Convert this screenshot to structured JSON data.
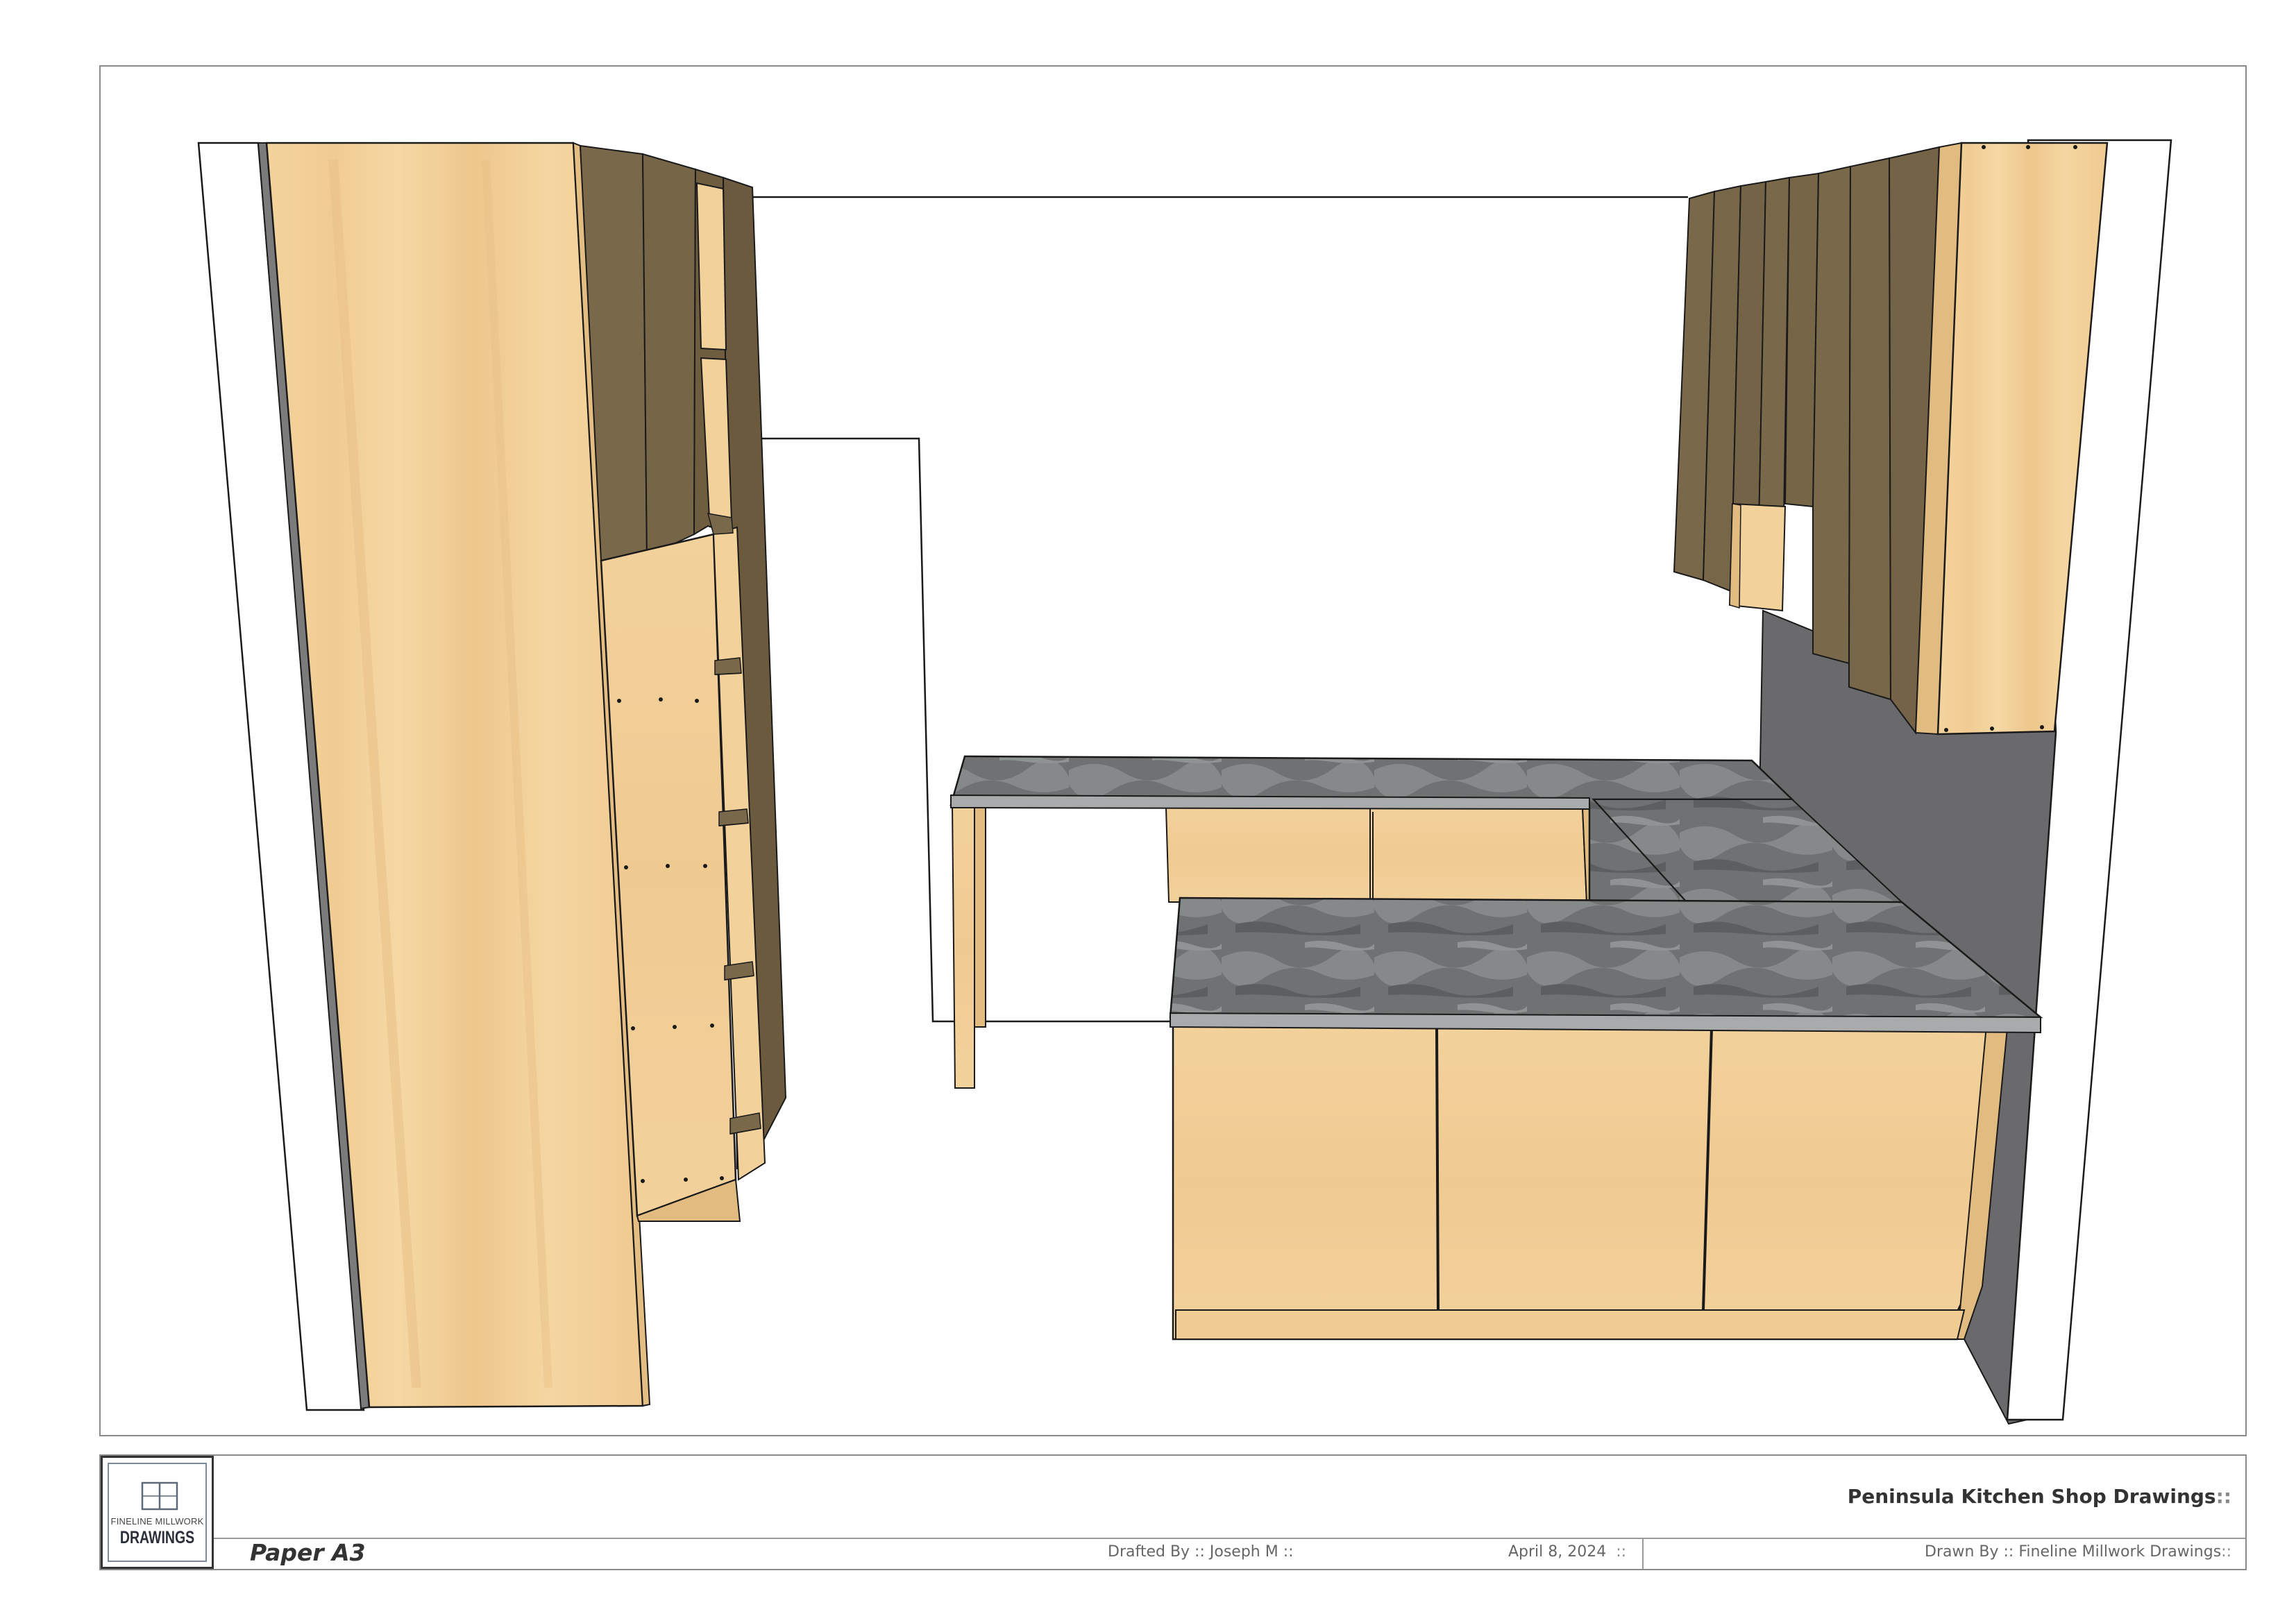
{
  "sheet": {
    "title": "Peninsula Kitchen Shop Drawings",
    "title_suffix": "::",
    "paper": "Paper A3",
    "drafted_by": "Drafted By :: Joseph M ::",
    "date": "April 8, 2024",
    "date_suffix": "::",
    "drawn_by": "Drawn By :: Fineline Millwork Drawings",
    "drawn_by_suffix": "::"
  },
  "logo": {
    "small_text": "FINELINE MILLWORK",
    "big_text": "DRAWINGS"
  },
  "colors": {
    "wood": "#f3d19b",
    "wood_shade": "#e2bb80",
    "dark_wood": "#7c6a4c",
    "dark_wood_side": "#6b5a3e",
    "countertop": "#6d6f70",
    "countertop_edge": "#a8aaab",
    "wall_shadow": "#6a6a6c",
    "outline": "#1a1a1a"
  }
}
